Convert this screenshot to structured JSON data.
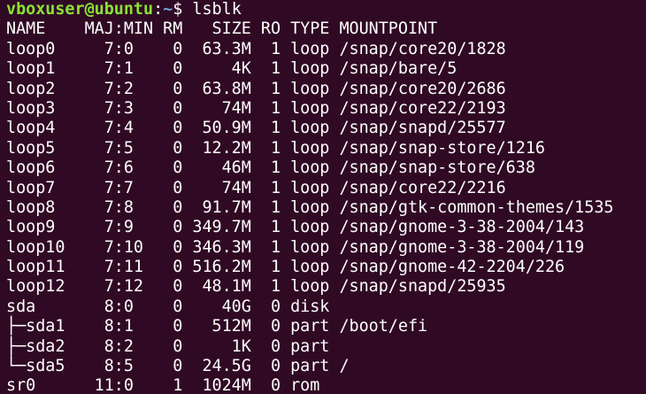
{
  "terminal": {
    "background": "#300a24",
    "prompt": {
      "user_host": "vboxuser@ubuntu",
      "colon": ":",
      "path": "~",
      "sign": "$ ",
      "command": "lsblk",
      "user_color": "#8ae234",
      "path_color": "#729fcf"
    },
    "header": "NAME    MAJ:MIN RM   SIZE RO TYPE MOUNTPOINT",
    "rows": [
      "loop0     7:0    0  63.3M  1 loop /snap/core20/1828",
      "loop1     7:1    0     4K  1 loop /snap/bare/5",
      "loop2     7:2    0  63.8M  1 loop /snap/core20/2686",
      "loop3     7:3    0    74M  1 loop /snap/core22/2193",
      "loop4     7:4    0  50.9M  1 loop /snap/snapd/25577",
      "loop5     7:5    0  12.2M  1 loop /snap/snap-store/1216",
      "loop6     7:6    0    46M  1 loop /snap/snap-store/638",
      "loop7     7:7    0    74M  1 loop /snap/core22/2216",
      "loop8     7:8    0  91.7M  1 loop /snap/gtk-common-themes/1535",
      "loop9     7:9    0 349.7M  1 loop /snap/gnome-3-38-2004/143",
      "loop10    7:10   0 346.3M  1 loop /snap/gnome-3-38-2004/119",
      "loop11    7:11   0 516.2M  1 loop /snap/gnome-42-2204/226",
      "loop12    7:12   0  48.1M  1 loop /snap/snapd/25935",
      "sda       8:0    0    40G  0 disk ",
      "├─sda1    8:1    0   512M  0 part /boot/efi",
      "├─sda2    8:2    0     1K  0 part ",
      "└─sda5    8:5    0  24.5G  0 part /",
      "sr0      11:0    1  1024M  0 rom  "
    ]
  }
}
